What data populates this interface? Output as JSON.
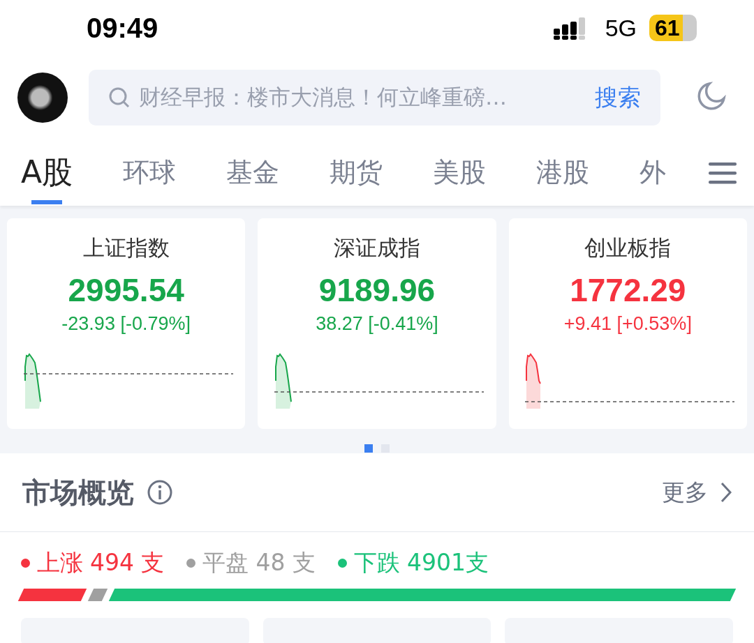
{
  "status_bar": {
    "time": "09:49",
    "network": "5G",
    "battery": "61"
  },
  "search": {
    "placeholder": "财经早报：楼市大消息！何立峰重磅…",
    "button": "搜索"
  },
  "tabs": [
    {
      "label": "A股",
      "selected": true
    },
    {
      "label": "环球",
      "selected": false
    },
    {
      "label": "基金",
      "selected": false
    },
    {
      "label": "期货",
      "selected": false
    },
    {
      "label": "美股",
      "selected": false
    },
    {
      "label": "港股",
      "selected": false
    },
    {
      "label": "外",
      "selected": false
    }
  ],
  "indices": [
    {
      "name": "上证指数",
      "value": "2995.54",
      "change": "-23.93 [-0.79%]",
      "kind": "down"
    },
    {
      "name": "深证成指",
      "value": "9189.96",
      "change": "38.27 [-0.41%]",
      "kind": "down"
    },
    {
      "name": "创业板指",
      "value": "1772.29",
      "change": "+9.41 [+0.53%]",
      "kind": "up"
    }
  ],
  "pager": [
    {
      "selected": true
    },
    {
      "selected": false
    }
  ],
  "overview": {
    "title": "市场概览",
    "more": "更多",
    "breadth": [
      {
        "label": "上涨",
        "count": "494 支",
        "color": "#f5333f"
      },
      {
        "label": "平盘",
        "count": "48 支",
        "color": "#a0a0a0"
      },
      {
        "label": "下跌",
        "count": "4901支",
        "color": "#1bc27a"
      }
    ]
  }
}
